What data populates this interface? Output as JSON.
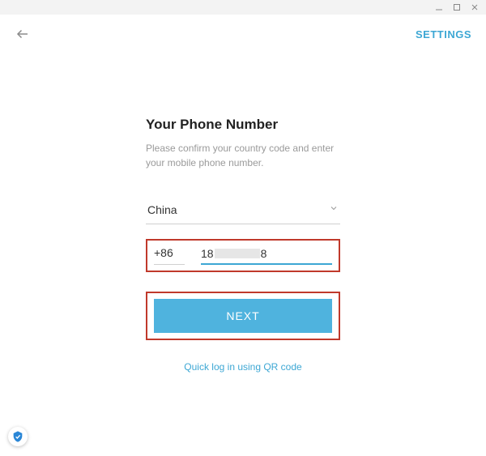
{
  "window": {
    "minimize": "minimize",
    "maximize": "maximize",
    "close": "close"
  },
  "topbar": {
    "settings_label": "SETTINGS"
  },
  "content": {
    "title": "Your Phone Number",
    "subtitle": "Please confirm your country code and enter your mobile phone number.",
    "country": "China",
    "country_code": "+86",
    "phone_prefix": "18",
    "phone_suffix": "8",
    "next_label": "NEXT",
    "qr_label": "Quick log in using QR code"
  },
  "colors": {
    "accent": "#3da7d4",
    "highlight": "#c0392b"
  }
}
